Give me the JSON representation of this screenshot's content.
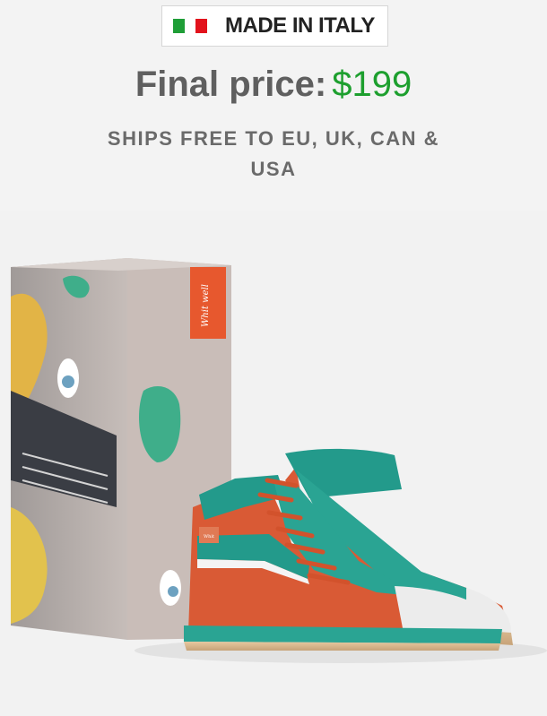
{
  "badge": {
    "flag_icon": "italy-flag-icon",
    "text": "MADE IN ITALY",
    "colors": {
      "green": "#1f9e37",
      "red": "#e2121c"
    }
  },
  "price": {
    "label": "Final price:",
    "value": "$199",
    "value_color": "#1d9f2e"
  },
  "shipping": {
    "text": "SHIPS FREE TO EU, UK, CAN & USA"
  },
  "product": {
    "box_label": "Whit well",
    "shoe_tag": "Whit",
    "shoe_colors": {
      "upper": "#d95a35",
      "collar": "#239a8b",
      "sole": "#d9b98f",
      "toe": "#e8e8e8",
      "laces": "#d2522c"
    }
  }
}
